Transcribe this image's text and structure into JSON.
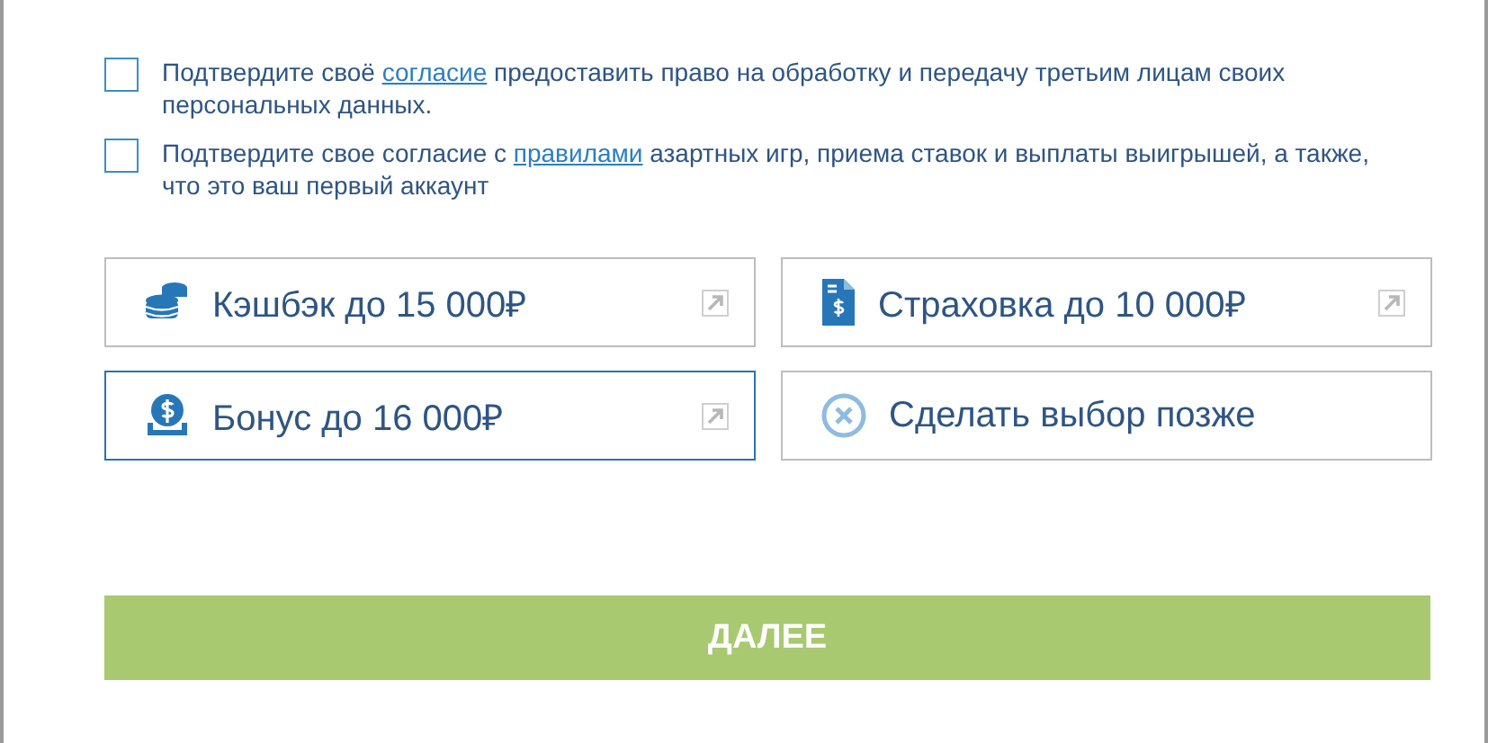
{
  "consents": [
    {
      "checked": false,
      "before": "Подтвердите своё ",
      "link": "согласие",
      "after": " предоставить право на обработку и передачу третьим лицам своих персональных данных."
    },
    {
      "checked": false,
      "before": "Подтвердите свое согласие с ",
      "link": "правилами",
      "after": " азартных игр, приема ставок и выплаты выигрышей, а также, что это ваш первый аккаунт"
    }
  ],
  "bonus_options": [
    {
      "kind": "coins",
      "label": "Кэшбэк до 15 000₽",
      "selected": false,
      "external": true
    },
    {
      "kind": "document",
      "label": "Страховка до 10 000₽",
      "selected": false,
      "external": true
    },
    {
      "kind": "money",
      "label": "Бонус до 16 000₽",
      "selected": true,
      "external": true
    },
    {
      "kind": "cancel",
      "label": "Сделать выбор позже",
      "selected": false,
      "external": false
    }
  ],
  "next_button": "ДАЛЕЕ"
}
